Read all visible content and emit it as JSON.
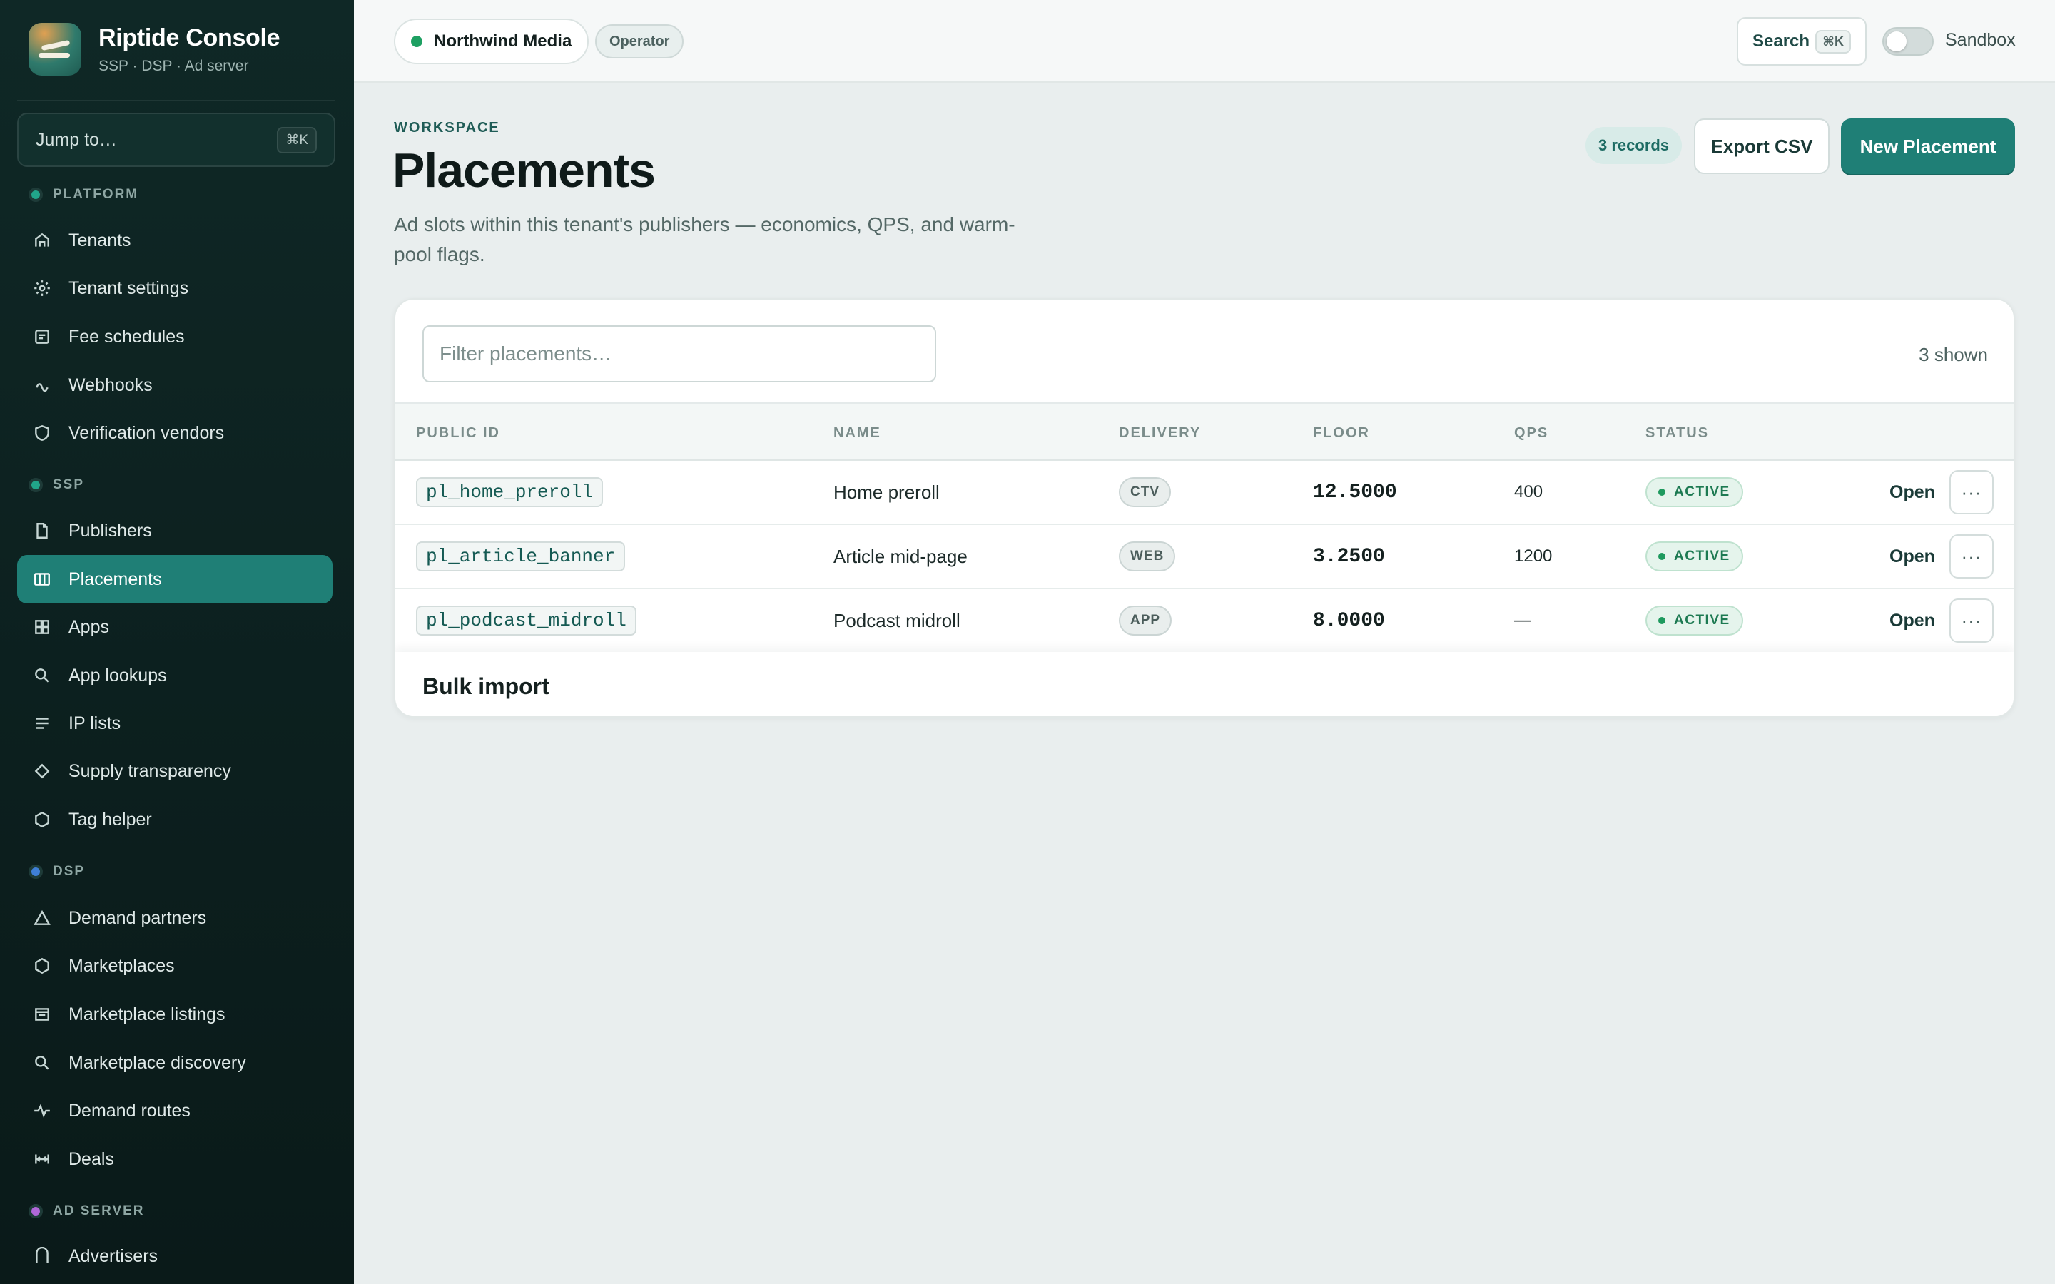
{
  "brand": {
    "title": "Riptide Console",
    "subtitle": "SSP · DSP · Ad server"
  },
  "jump": {
    "label": "Jump to…",
    "shortcut": "⌘K"
  },
  "sidebar": {
    "sections": [
      {
        "label": "PLATFORM",
        "color": "#21a58a"
      },
      {
        "label": "SSP",
        "color": "#21a58a"
      },
      {
        "label": "DSP",
        "color": "#3f7fd6"
      },
      {
        "label": "AD SERVER",
        "color": "#b067d8"
      }
    ],
    "items": [
      {
        "label": "Tenants",
        "icon": "home-icon"
      },
      {
        "label": "Tenant settings",
        "icon": "gear-icon"
      },
      {
        "label": "Fee schedules",
        "icon": "receipt-icon"
      },
      {
        "label": "Webhooks",
        "icon": "webhook-icon"
      },
      {
        "label": "Verification vendors",
        "icon": "shield-icon"
      },
      {
        "label": "Publishers",
        "icon": "document-icon"
      },
      {
        "label": "Placements",
        "icon": "columns-icon",
        "active": true
      },
      {
        "label": "Apps",
        "icon": "grid-icon"
      },
      {
        "label": "App lookups",
        "icon": "search-icon"
      },
      {
        "label": "IP lists",
        "icon": "list-icon"
      },
      {
        "label": "Supply transparency",
        "icon": "diamond-icon"
      },
      {
        "label": "Tag helper",
        "icon": "hexagon-icon"
      },
      {
        "label": "Demand partners",
        "icon": "triangle-icon"
      },
      {
        "label": "Marketplaces",
        "icon": "hexagon-icon"
      },
      {
        "label": "Marketplace listings",
        "icon": "store-icon"
      },
      {
        "label": "Marketplace discovery",
        "icon": "search-icon"
      },
      {
        "label": "Demand routes",
        "icon": "pulse-icon"
      },
      {
        "label": "Deals",
        "icon": "deal-icon"
      },
      {
        "label": "Advertisers",
        "icon": "building-icon"
      }
    ]
  },
  "topbar": {
    "tenant": "Northwind Media",
    "role": "Operator",
    "search_label": "Search",
    "search_shortcut": "⌘K",
    "sandbox_label": "Sandbox",
    "sandbox_on": false
  },
  "header": {
    "eyebrow": "WORKSPACE",
    "title": "Placements",
    "description": "Ad slots within this tenant's publishers — economics, QPS, and warm-pool flags.",
    "records_badge": "3 records",
    "export_label": "Export CSV",
    "new_label": "New Placement"
  },
  "table": {
    "filter_placeholder": "Filter placements…",
    "shown": "3 shown",
    "columns": [
      "PUBLIC ID",
      "NAME",
      "DELIVERY",
      "FLOOR",
      "QPS",
      "STATUS"
    ],
    "rows": [
      {
        "public_id": "pl_home_preroll",
        "name": "Home preroll",
        "delivery": "CTV",
        "floor": "12.5000",
        "qps": "400",
        "status": "ACTIVE",
        "action": "Open"
      },
      {
        "public_id": "pl_article_banner",
        "name": "Article mid-page",
        "delivery": "WEB",
        "floor": "3.2500",
        "qps": "1200",
        "status": "ACTIVE",
        "action": "Open"
      },
      {
        "public_id": "pl_podcast_midroll",
        "name": "Podcast midroll",
        "delivery": "APP",
        "floor": "8.0000",
        "qps": "—",
        "status": "ACTIVE",
        "action": "Open"
      }
    ],
    "more_label": "···"
  },
  "bulk": {
    "title": "Bulk import"
  },
  "colors": {
    "accent": "#1f7f76",
    "sidebar_bg": "#0f2826",
    "active_status": "#1e9a5e"
  }
}
